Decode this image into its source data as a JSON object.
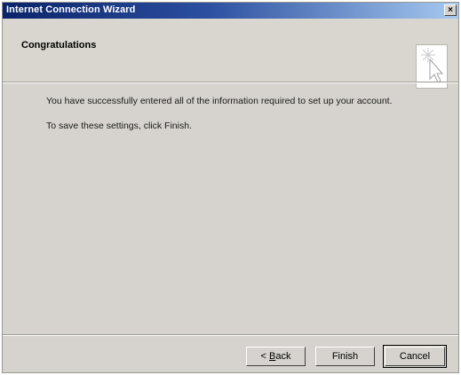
{
  "window": {
    "title": "Internet Connection Wizard",
    "close_glyph": "×"
  },
  "header": {
    "title": "Congratulations",
    "icon": "wizard-cursor-sparkle-icon"
  },
  "content": {
    "line1": "You have successfully entered all of the information required to set up your account.",
    "line2": "To save these settings, click Finish."
  },
  "buttons": {
    "back_prefix": "< ",
    "back_hotkey": "B",
    "back_rest": "ack",
    "finish": "Finish",
    "cancel": "Cancel"
  },
  "colors": {
    "titlebar_start": "#0a246a",
    "titlebar_end": "#a6caf0",
    "dialog_bg": "#d6d3ce"
  }
}
